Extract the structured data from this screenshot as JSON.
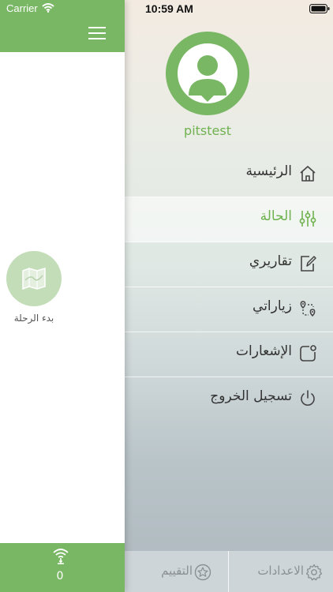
{
  "status_bar": {
    "carrier": "Carrier",
    "time": "10:59 AM"
  },
  "content_panel": {
    "start_trip_label": "بدء الرحلة",
    "footer_count": "0"
  },
  "drawer": {
    "username": "pitstest",
    "menu": [
      {
        "label": "الرئيسية",
        "icon": "home-icon",
        "active": false
      },
      {
        "label": "الحالة",
        "icon": "sliders-icon",
        "active": true
      },
      {
        "label": "تقاريري",
        "icon": "edit-report-icon",
        "active": false
      },
      {
        "label": "زياراتي",
        "icon": "route-icon",
        "active": false
      },
      {
        "label": "الإشعارات",
        "icon": "notification-icon",
        "active": false
      },
      {
        "label": "تسجيل الخروج",
        "icon": "power-icon",
        "active": false
      }
    ],
    "bottom": {
      "rate_label": "التقييم",
      "settings_label": "الاعدادات"
    }
  },
  "colors": {
    "brand_green": "#79b765",
    "active_text": "#6fb24f"
  }
}
